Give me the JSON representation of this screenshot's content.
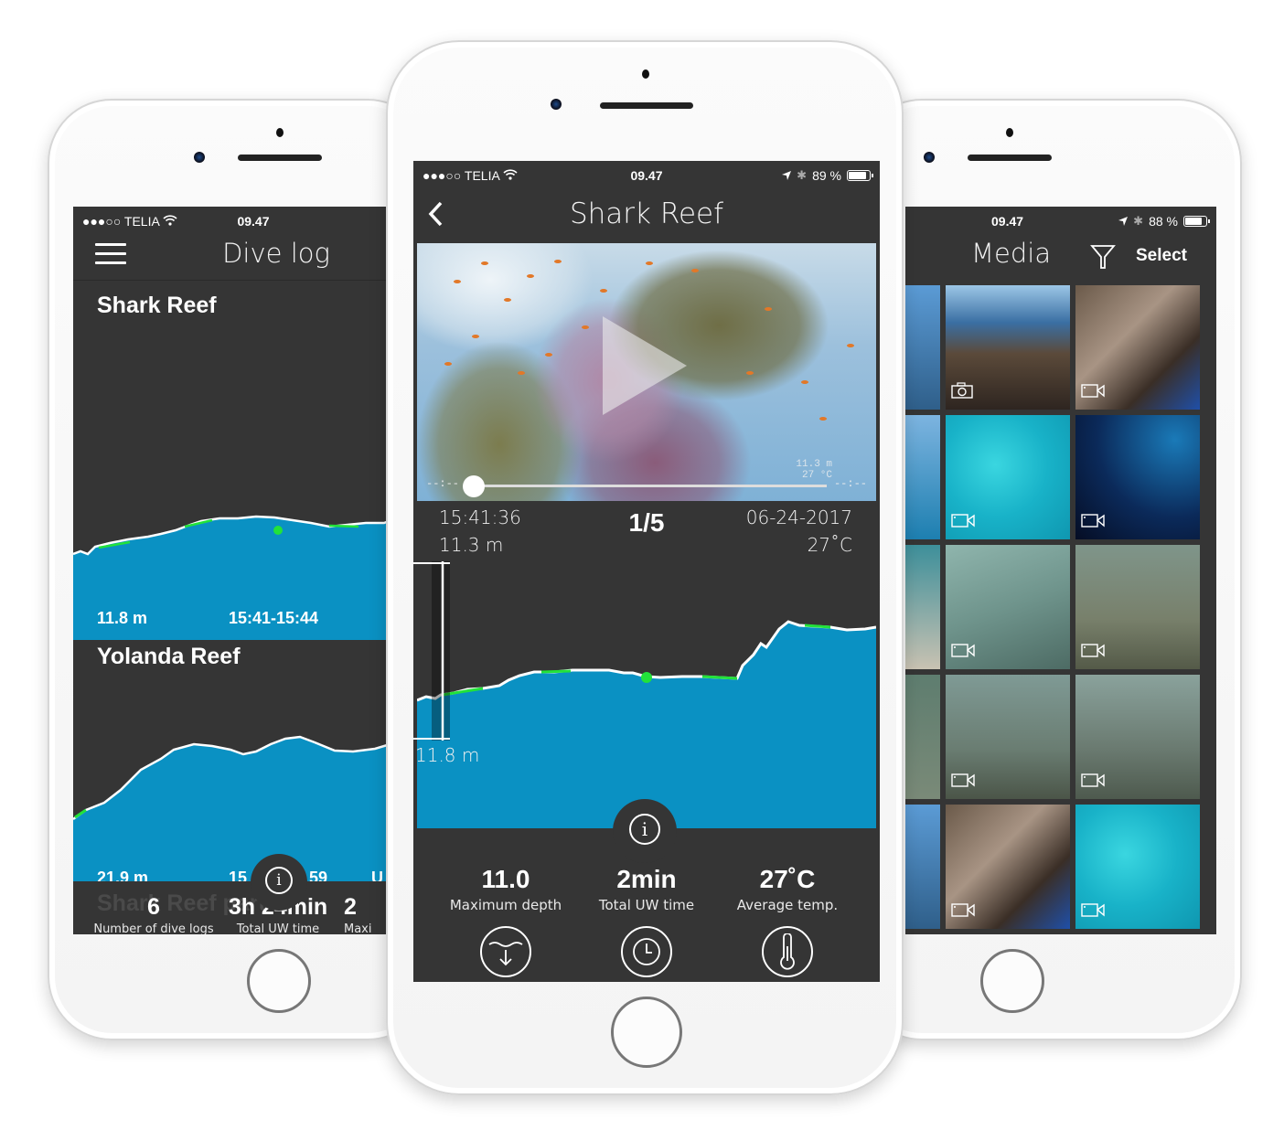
{
  "status_bar": {
    "carrier_signal": "●●●○○",
    "carrier": "TELIA",
    "time": "09.47",
    "battery_center": "89 %",
    "battery_right": "88 %",
    "battery_center_level": 0.89,
    "battery_right_level": 0.88
  },
  "dive_log_screen": {
    "title": "Dive log",
    "entries": [
      {
        "name": "Shark Reef",
        "max_depth": "11.8 m",
        "time_range": "15:41-15:44"
      },
      {
        "name": "Yolanda Reef",
        "max_depth": "21.9 m",
        "time_range_partial": "15",
        "time_range_end": "59",
        "extra": "U"
      }
    ],
    "ghost_title": "Shark Reef part 2",
    "summary": [
      {
        "value": "6",
        "label": "Number of dive logs",
        "icon": "dive-icon"
      },
      {
        "value": "3h 24min",
        "label": "Total UW time",
        "icon": "clock-icon"
      },
      {
        "value": "2",
        "label": "Maxi",
        "icon": "depth-icon"
      }
    ]
  },
  "dive_detail_screen": {
    "title": "Shark Reef",
    "video": {
      "start_time": "--:--",
      "end_time": "--:--",
      "osd_depth": "11.3 m",
      "osd_temp": "27 °C",
      "progress": 0.0
    },
    "current_time": "15:41:36",
    "current_depth": "11.3 m",
    "counter": "1/5",
    "date": "06-24-2017",
    "temperature": "27˚C",
    "depth_marker_label": "11.8 m",
    "stats": [
      {
        "value": "11.0",
        "label": "Maximum depth",
        "icon": "depth-icon"
      },
      {
        "value": "2min",
        "label": "Total UW time",
        "icon": "clock-icon"
      },
      {
        "value": "27˚C",
        "label": "Average temp.",
        "icon": "thermometer-icon"
      }
    ]
  },
  "media_screen": {
    "title": "Media",
    "select_label": "Select",
    "thumbnails": [
      {
        "type": "photo",
        "scene": "rocky shore with camera gear"
      },
      {
        "type": "video",
        "scene": "rocks close-up"
      },
      {
        "type": "video",
        "scene": "turquoise water"
      },
      {
        "type": "video",
        "scene": "deep blue diver"
      },
      {
        "type": "video",
        "scene": "wreck deck"
      },
      {
        "type": "video",
        "scene": "wreck debris"
      },
      {
        "type": "video",
        "scene": "wreck barrel"
      },
      {
        "type": "video",
        "scene": "wreck porthole"
      },
      {
        "type": "video",
        "scene": "rocks close-up"
      },
      {
        "type": "video",
        "scene": "turquoise water"
      }
    ]
  },
  "colors": {
    "screen_bg": "#353535",
    "depth_fill": "#0a91c3",
    "profile_line": "#ffffff",
    "highlight_green": "#22e23a"
  }
}
